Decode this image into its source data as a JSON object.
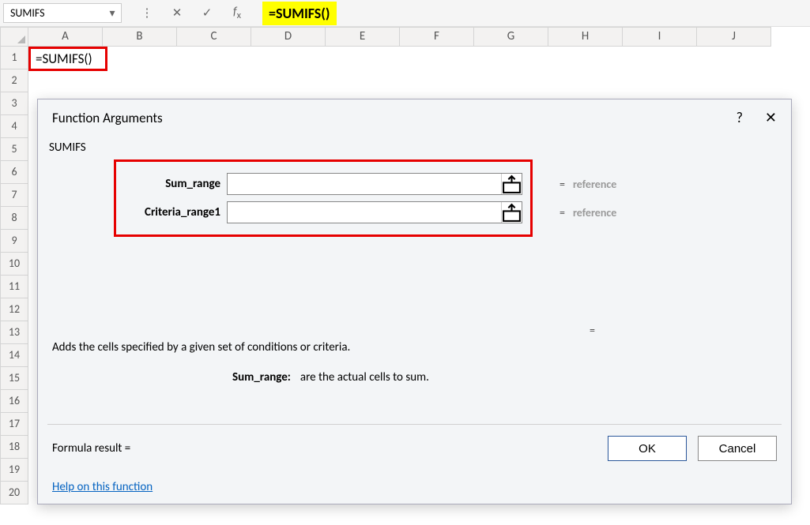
{
  "nameBox": "SUMIFS",
  "formulaBar": "=SUMIFS()",
  "columns": [
    "A",
    "B",
    "C",
    "D",
    "E",
    "F",
    "G",
    "H",
    "I",
    "J"
  ],
  "rowCount": 20,
  "cellA1": "=SUMIFS()",
  "dialog": {
    "title": "Function Arguments",
    "functionName": "SUMIFS",
    "args": [
      {
        "label": "Sum_range",
        "value": "",
        "hint": "reference"
      },
      {
        "label": "Criteria_range1",
        "value": "",
        "hint": "reference"
      }
    ],
    "resultEq": "=",
    "description": "Adds the cells specified by a given set of conditions or criteria.",
    "argHelpLabel": "Sum_range:",
    "argHelpText": "are the actual cells to sum.",
    "formulaResultLabel": "Formula result =",
    "formulaResultValue": "",
    "helpLink": "Help on this function",
    "okLabel": "OK",
    "cancelLabel": "Cancel"
  }
}
